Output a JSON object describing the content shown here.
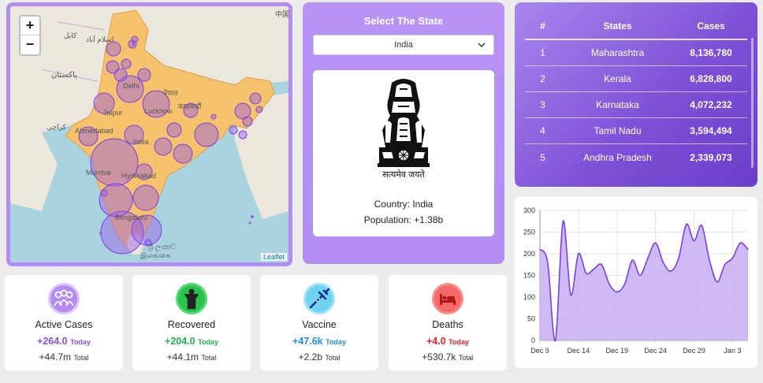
{
  "map": {
    "zoom_in": "+",
    "zoom_out": "−",
    "attribution": "Leaflet",
    "labels": {
      "china": "中国",
      "kabul": "کابل",
      "islamabad": "اسلام آباد",
      "pakistan": "پاکستان",
      "delhi": "Delhi",
      "nepal": "नेपाल",
      "kathmandu": "काठमाडौं",
      "jaipur": "Jaipur",
      "lucknow": "Lucknow",
      "karachi": "کراچی",
      "ahmedabad": "Ahmedabad",
      "india": "India",
      "mumbai": "Mumbai",
      "hyderabad": "Hyderabad",
      "bengaluru": "Bengaluru",
      "srilanka_si": "ශ්‍රී ලංකාව",
      "srilanka_ta": "இலங்கை"
    }
  },
  "selector": {
    "title": "Select The State",
    "selected": "India",
    "motto": "सत्यमेव जयते",
    "country_line": "Country: India",
    "population_line": "Population: +1.38b"
  },
  "table": {
    "headers": [
      "#",
      "States",
      "Cases"
    ],
    "rows": [
      {
        "rank": "1",
        "state": "Maharashtra",
        "cases": "8,136,780"
      },
      {
        "rank": "2",
        "state": "Kerala",
        "cases": "6,828,800"
      },
      {
        "rank": "3",
        "state": "Karnataka",
        "cases": "4,072,232"
      },
      {
        "rank": "4",
        "state": "Tamil Nadu",
        "cases": "3,594,494"
      },
      {
        "rank": "5",
        "state": "Andhra Pradesh",
        "cases": "2,339,073"
      }
    ]
  },
  "stats": [
    {
      "label": "Active Cases",
      "today": "+264.0",
      "today_suffix": "Today",
      "total": "+44.7m",
      "total_suffix": "Total",
      "color": "#8a4fdb",
      "icon": "people-icon",
      "icon_bg": "#d9c3fb"
    },
    {
      "label": "Recovered",
      "today": "+204.0",
      "today_suffix": "Today",
      "total": "+44.1m",
      "total_suffix": "Total",
      "color": "#1eb34d",
      "icon": "person-recovered-icon",
      "icon_bg": "#4ddc6e"
    },
    {
      "label": "Vaccine",
      "today": "+47.6k",
      "today_suffix": "Today",
      "total": "+2.2b",
      "total_suffix": "Total",
      "color": "#1c8fe0",
      "icon": "syringe-icon",
      "icon_bg": "#9fe3f7"
    },
    {
      "label": "Deaths",
      "today": "+4.0",
      "today_suffix": "Today",
      "total": "+530.7k",
      "total_suffix": "Total",
      "color": "#e01f1f",
      "icon": "bed-icon",
      "icon_bg": "#f98b8b"
    }
  ],
  "chart_data": {
    "type": "area",
    "x": [
      "Dec 9",
      "Dec 10",
      "Dec 11",
      "Dec 12",
      "Dec 13",
      "Dec 14",
      "Dec 15",
      "Dec 16",
      "Dec 17",
      "Dec 18",
      "Dec 19",
      "Dec 20",
      "Dec 21",
      "Dec 22",
      "Dec 23",
      "Dec 24",
      "Dec 25",
      "Dec 26",
      "Dec 27",
      "Dec 28",
      "Dec 29",
      "Dec 30",
      "Dec 31",
      "Jan 1",
      "Jan 2",
      "Jan 3",
      "Jan 4",
      "Jan 5"
    ],
    "x_tick_labels": [
      "Dec 9",
      "Dec 14",
      "Dec 19",
      "Dec 24",
      "Dec 29",
      "Jan 3"
    ],
    "values": [
      210,
      180,
      0,
      275,
      105,
      200,
      155,
      165,
      175,
      130,
      112,
      130,
      185,
      150,
      190,
      225,
      180,
      160,
      190,
      268,
      230,
      265,
      185,
      135,
      175,
      190,
      225,
      210
    ],
    "ylim": [
      0,
      300
    ],
    "y_ticks": [
      0,
      50,
      100,
      150,
      200,
      250,
      300
    ],
    "grid": true,
    "line_color": "#7d3fe0",
    "fill_color": "#c8aef5"
  }
}
